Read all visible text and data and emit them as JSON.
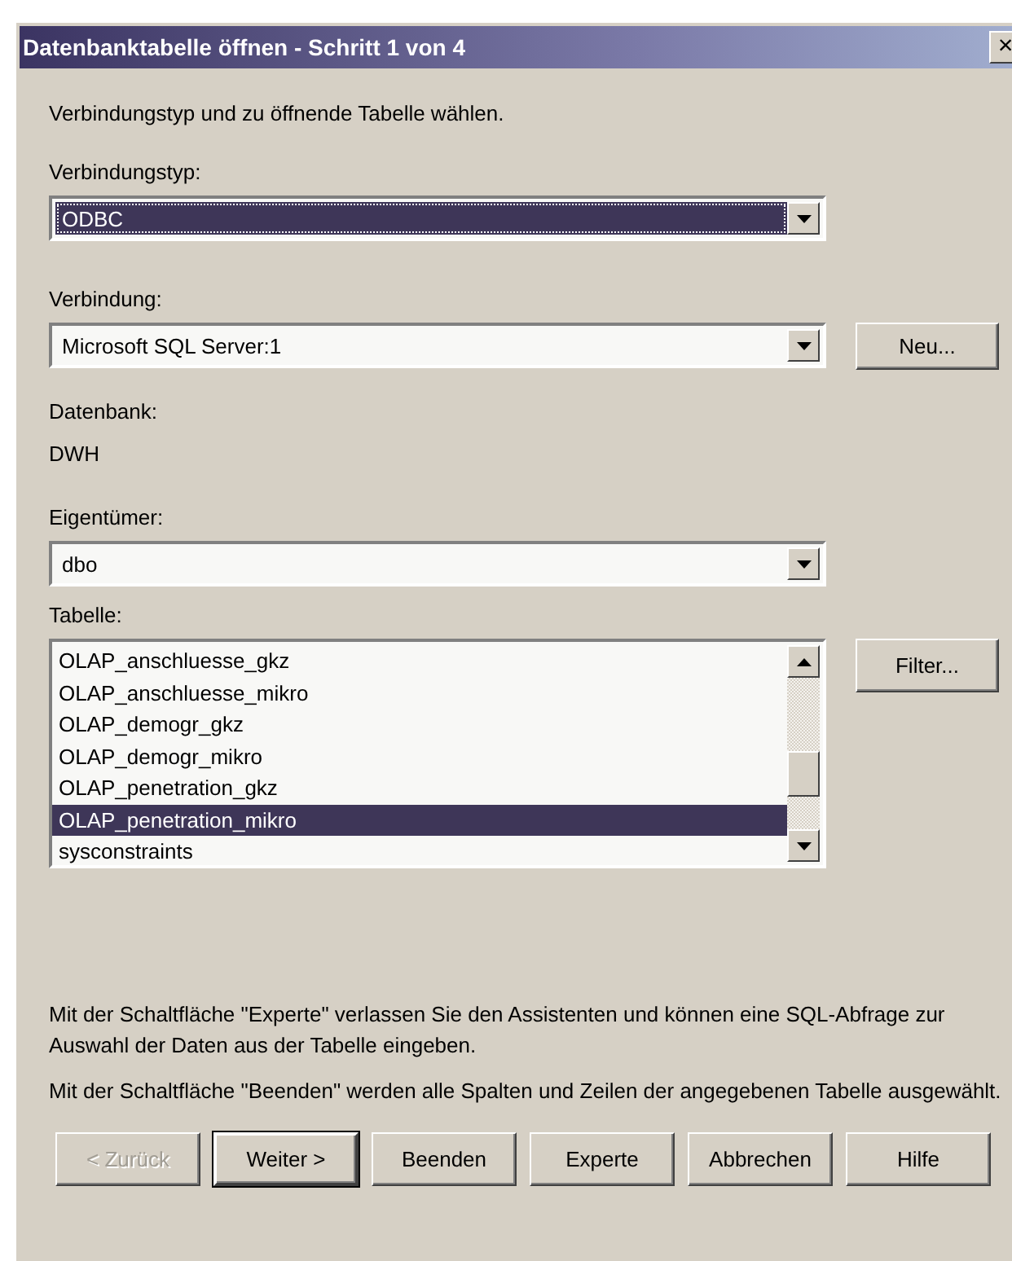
{
  "window": {
    "title": "Datenbanktabelle öffnen - Schritt 1 von 4",
    "close": "×"
  },
  "intro": "Verbindungstyp und zu öffnende Tabelle wählen.",
  "connection_type": {
    "label": "Verbindungstyp:",
    "value": "ODBC",
    "focused": true
  },
  "connection": {
    "label": "Verbindung:",
    "value": "Microsoft SQL Server:1",
    "button": "Neu..."
  },
  "database": {
    "label": "Datenbank:",
    "value": "DWH"
  },
  "owner": {
    "label": "Eigentümer:",
    "value": "dbo",
    "focused": false
  },
  "table": {
    "label": "Tabelle:",
    "button": "Filter...",
    "items": [
      {
        "label": "OLAP_anschluesse_gkz",
        "selected": false
      },
      {
        "label": "OLAP_anschluesse_mikro",
        "selected": false
      },
      {
        "label": "OLAP_demogr_gkz",
        "selected": false
      },
      {
        "label": "OLAP_demogr_mikro",
        "selected": false
      },
      {
        "label": "OLAP_penetration_gkz",
        "selected": false
      },
      {
        "label": "OLAP_penetration_mikro",
        "selected": true
      },
      {
        "label": "sysconstraints",
        "selected": false
      }
    ]
  },
  "notes": [
    "Mit der Schaltfläche \"Experte\" verlassen Sie den Assistenten und können eine SQL-Abfrage zur Auswahl der Daten aus der Tabelle eingeben.",
    "Mit der Schaltfläche \"Beenden\" werden alle Spalten und Zeilen der angegebenen Tabelle ausgewählt."
  ],
  "buttons": [
    {
      "label": "< Zurück",
      "disabled": true,
      "default": false
    },
    {
      "label": "Weiter >",
      "disabled": false,
      "default": true
    },
    {
      "label": "Beenden",
      "disabled": false,
      "default": false
    },
    {
      "label": "Experte",
      "disabled": false,
      "default": false
    },
    {
      "label": "Abbrechen",
      "disabled": false,
      "default": false
    },
    {
      "label": "Hilfe",
      "disabled": false,
      "default": false
    }
  ]
}
